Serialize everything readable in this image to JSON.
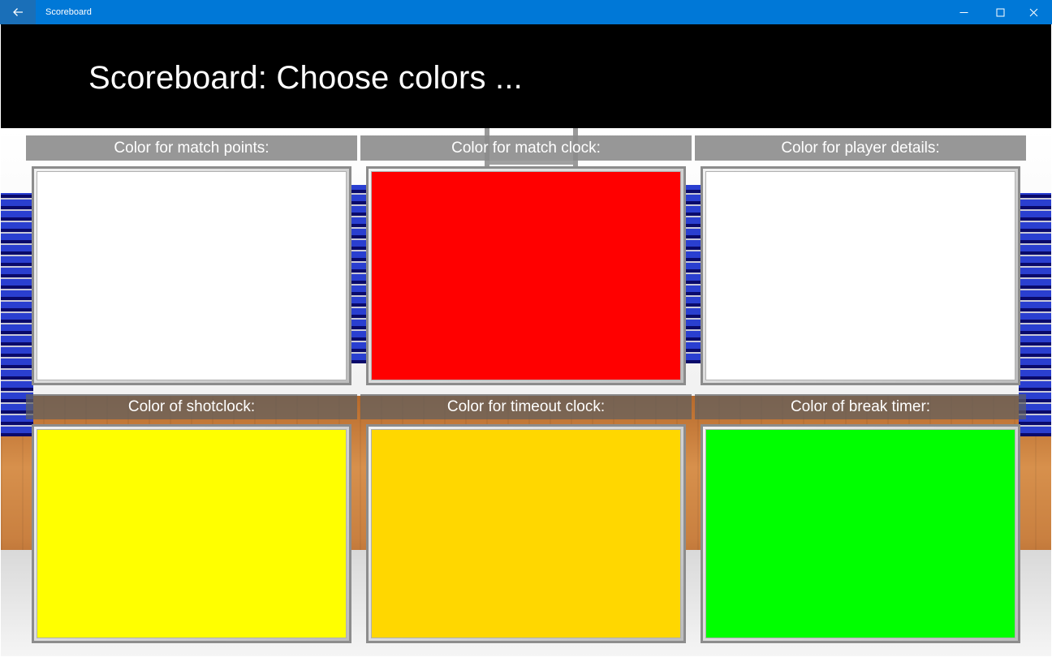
{
  "window": {
    "title": "Scoreboard",
    "icons": {
      "back": "back-arrow-icon",
      "minimize": "minimize-icon",
      "maximize": "maximize-icon",
      "close": "close-icon"
    },
    "accent_color": "#0078d7"
  },
  "header": {
    "title": "Scoreboard: Choose colors ..."
  },
  "panels": [
    {
      "label": "Color for match points:",
      "color": "#ffffff"
    },
    {
      "label": "Color for match clock:",
      "color": "#ff0000"
    },
    {
      "label": "Color for player details:",
      "color": "#ffffff"
    },
    {
      "label": "Color of shotclock:",
      "color": "#ffff00"
    },
    {
      "label": "Color for timeout clock:",
      "color": "#ffd700"
    },
    {
      "label": "Color of break timer:",
      "color": "#00ff00"
    }
  ]
}
